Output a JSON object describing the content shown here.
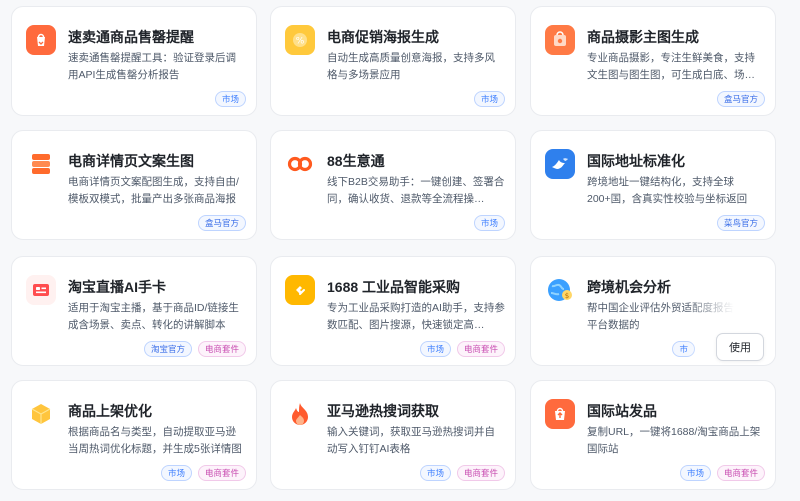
{
  "cards": [
    {
      "title": "速卖通商品售罄提醒",
      "desc": "速卖通售罄提醒工具：验证登录后调用API生成售罄分析报告",
      "tags": [
        {
          "label": "市场",
          "kind": "market"
        }
      ],
      "icon": "shopping-bag-icon",
      "color": "#ff6a3d"
    },
    {
      "title": "电商促销海报生成",
      "desc": "自动生成高质量创意海报，支持多风格与多场景应用",
      "tags": [
        {
          "label": "市场",
          "kind": "market"
        }
      ],
      "icon": "percent-tag-icon",
      "color": "#ffc93c"
    },
    {
      "title": "商品摄影主图生成",
      "desc": "专业商品摄影，专注生鲜美食，支持文生图与图生图，可生成白底、场…",
      "tags": [
        {
          "label": "盒马官方",
          "kind": "official"
        }
      ],
      "icon": "photo-bag-icon",
      "color": "#ff7a45"
    },
    {
      "title": "电商详情页文案生图",
      "desc": "电商详情页文案配图生成，支持自由/模板双模式，批量产出多张商品海报",
      "tags": [
        {
          "label": "盒马官方",
          "kind": "official"
        }
      ],
      "icon": "layers-icon",
      "color": "#ff6b2c"
    },
    {
      "title": "88生意通",
      "desc": "线下B2B交易助手：一键创建、签署合同，确认收货、退款等全流程操…",
      "tags": [
        {
          "label": "市场",
          "kind": "market"
        }
      ],
      "icon": "infinity-icon",
      "color": "#ff5a1f"
    },
    {
      "title": "国际地址标准化",
      "desc": "跨境地址一键结构化，支持全球200+国，含真实性校验与坐标返回",
      "tags": [
        {
          "label": "菜鸟官方",
          "kind": "official"
        }
      ],
      "icon": "bird-icon",
      "color": "#2f80ed"
    },
    {
      "title": "淘宝直播AI手卡",
      "desc": "适用于淘宝主播，基于商品ID/链接生成含场景、卖点、转化的讲解脚本",
      "tags": [
        {
          "label": "淘宝官方",
          "kind": "official"
        },
        {
          "label": "电商套件",
          "kind": "suite"
        }
      ],
      "icon": "card-icon",
      "color": "#ff4d4f"
    },
    {
      "title": "1688 工业品智能采购",
      "desc": "专为工业品采购打造的AI助手，支持参数匹配、图片搜源，快速锁定高…",
      "tags": [
        {
          "label": "市场",
          "kind": "market"
        },
        {
          "label": "电商套件",
          "kind": "suite"
        }
      ],
      "icon": "cube-arrow-icon",
      "color": "#ffb800"
    },
    {
      "title": "跨境机会分析",
      "desc": "帮中国企业评估外贸适配度报告及含平台数据的",
      "tags": [
        {
          "label": "市",
          "kind": "market"
        }
      ],
      "icon": "globe-icon",
      "color": "#3aa0ff",
      "button": "使用"
    },
    {
      "title": "商品上架优化",
      "desc": "根据商品名与类型，自动提取亚马逊当周热词优化标题，并生成5张详情图",
      "tags": [
        {
          "label": "市场",
          "kind": "market"
        },
        {
          "label": "电商套件",
          "kind": "suite"
        }
      ],
      "icon": "box-icon",
      "color": "#ffc53d"
    },
    {
      "title": "亚马逊热搜词获取",
      "desc": "输入关键词，获取亚马逊热搜词并自动写入钉钉AI表格",
      "tags": [
        {
          "label": "市场",
          "kind": "market"
        },
        {
          "label": "电商套件",
          "kind": "suite"
        }
      ],
      "icon": "flame-icon",
      "color": "#ff5b2e"
    },
    {
      "title": "国际站发品",
      "desc": "复制URL，一键将1688/淘宝商品上架国际站",
      "tags": [
        {
          "label": "市场",
          "kind": "market"
        },
        {
          "label": "电商套件",
          "kind": "suite"
        }
      ],
      "icon": "upload-bag-icon",
      "color": "#ff6a3d"
    }
  ]
}
